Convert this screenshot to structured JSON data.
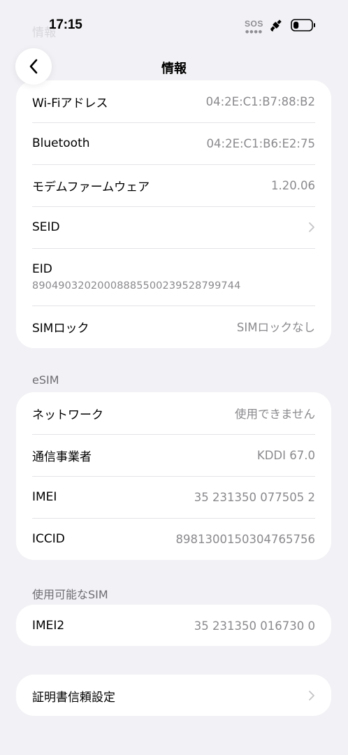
{
  "status_bar": {
    "time": "17:15",
    "sos": "SOS",
    "satellite_icon": "satellite-icon",
    "battery_icon": "battery-icon",
    "battery_level": 0.3
  },
  "ghost_title": "情報",
  "nav": {
    "title": "情報",
    "back_icon": "chevron-left-icon"
  },
  "info": {
    "wifi_label": "Wi-Fiアドレス",
    "wifi_value": "04:2E:C1:B7:88:B2",
    "bluetooth_label": "Bluetooth",
    "bluetooth_value": "04:2E:C1:B6:E2:75",
    "modem_label": "モデムファームウェア",
    "modem_value": "1.20.06",
    "seid_label": "SEID",
    "eid_label": "EID",
    "eid_value": "89049032020008885500239528799744",
    "simlock_label": "SIMロック",
    "simlock_value": "SIMロックなし"
  },
  "esim": {
    "header": "eSIM",
    "network_label": "ネットワーク",
    "network_value": "使用できません",
    "carrier_label": "通信事業者",
    "carrier_value": "KDDI 67.0",
    "imei_label": "IMEI",
    "imei_value": "35 231350 077505 2",
    "iccid_label": "ICCID",
    "iccid_value": "8981300150304765756"
  },
  "available_sim": {
    "header": "使用可能なSIM",
    "imei2_label": "IMEI2",
    "imei2_value": "35 231350 016730 0"
  },
  "certificate": {
    "label": "証明書信頼設定"
  },
  "colors": {
    "background": "#f2f2f6",
    "card": "#ffffff",
    "secondary_text": "#8a8a8e",
    "separator": "#e4e4e8"
  }
}
